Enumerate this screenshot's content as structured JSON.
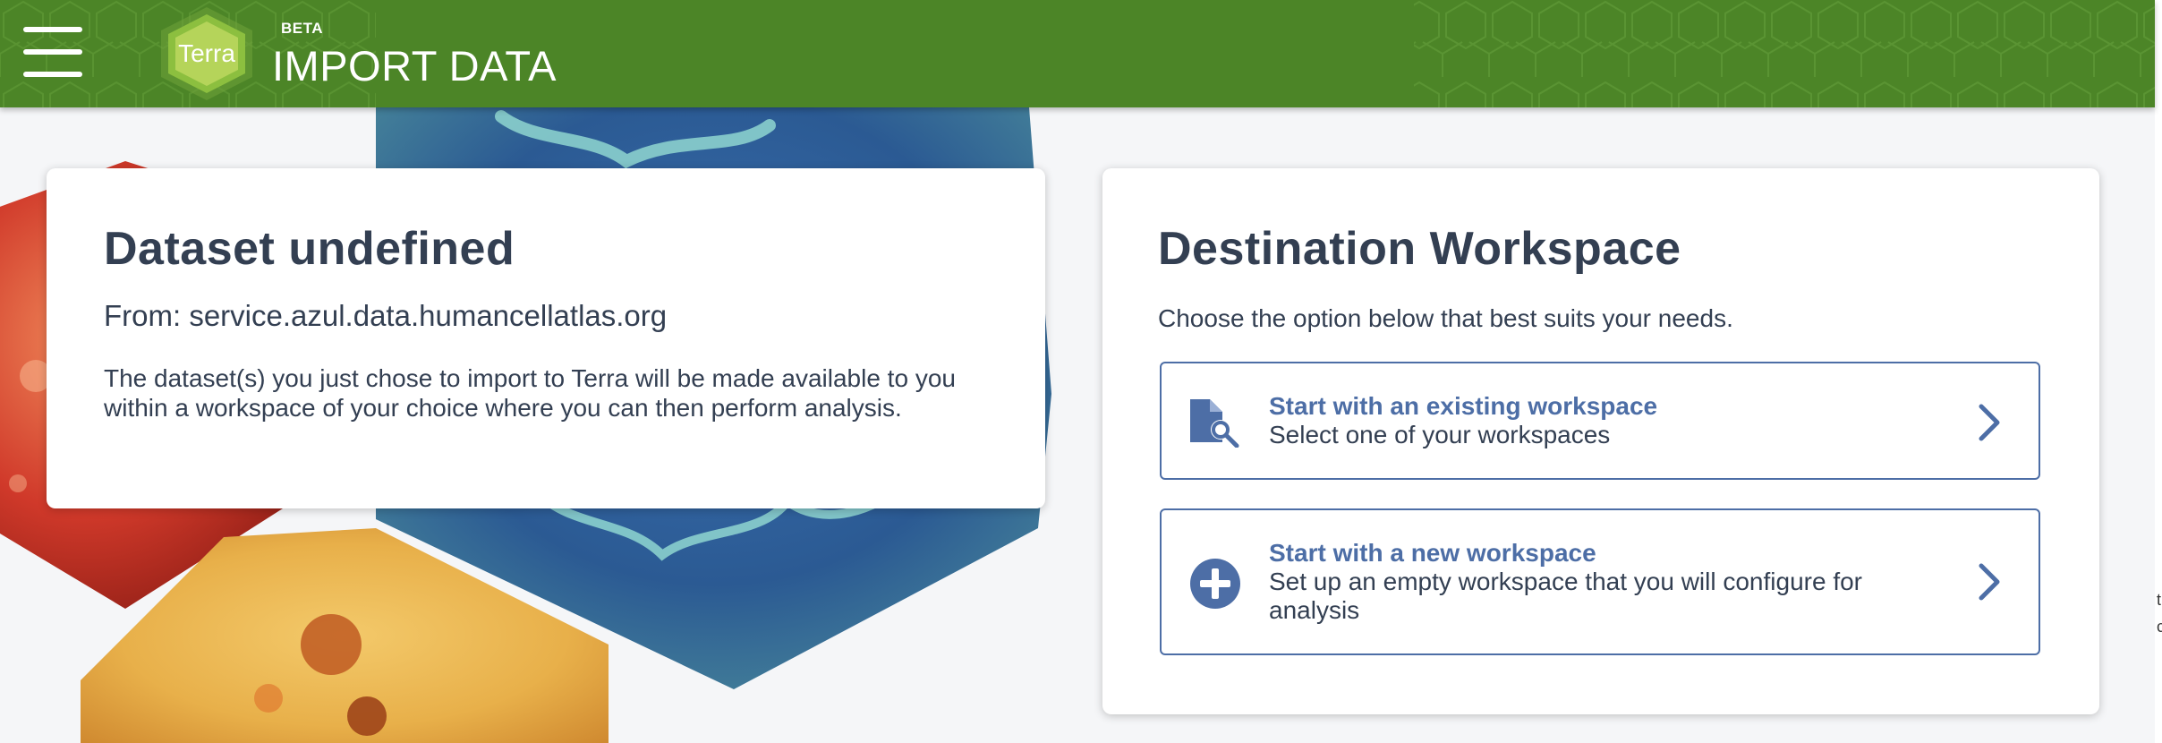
{
  "header": {
    "badge": "BETA",
    "title": "IMPORT DATA",
    "logo_text": "Terra"
  },
  "dataset_card": {
    "title": "Dataset undefined",
    "from": "From: service.azul.data.humancellatlas.org",
    "description": "The dataset(s) you just chose to import to Terra will be made available to you within a workspace of your choice where you can then perform analysis."
  },
  "destination_card": {
    "title": "Destination Workspace",
    "subtitle": "Choose the option below that best suits your needs.",
    "options": [
      {
        "title": "Start with an existing workspace",
        "subtitle": "Select one of your workspaces",
        "icon": "document-search-icon"
      },
      {
        "title": "Start with a new workspace",
        "subtitle": "Set up an empty workspace that you will configure for analysis",
        "icon": "plus-circle-icon"
      }
    ]
  },
  "colors": {
    "header_green": "#4c8527",
    "accent_blue": "#4d6ea6",
    "text_dark": "#333f52",
    "logo_lime": "#b5d45a"
  },
  "edge_glyphs": "t c"
}
